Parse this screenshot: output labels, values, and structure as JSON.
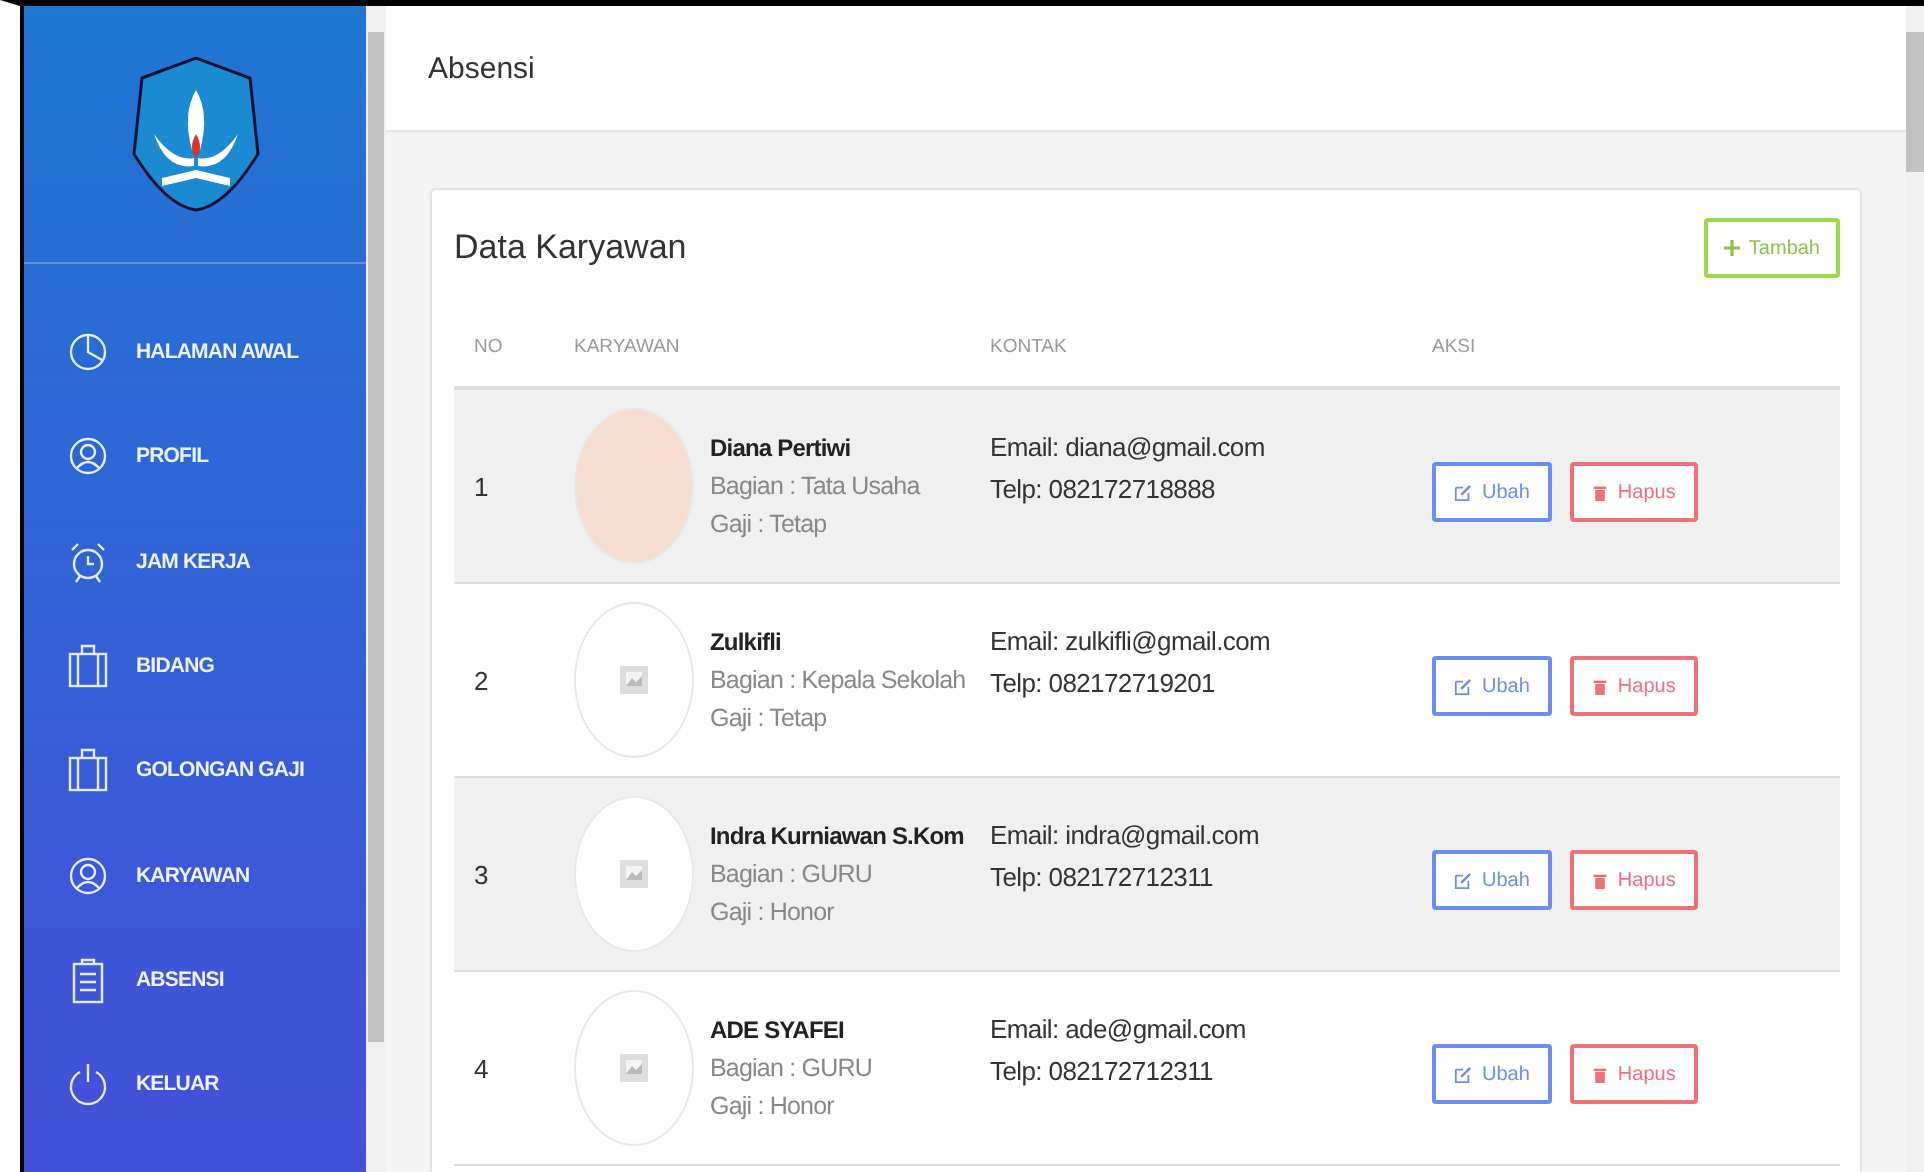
{
  "sidebar": {
    "items": [
      {
        "label": "HALAMAN AWAL",
        "kind": "chart"
      },
      {
        "label": "PROFIL",
        "kind": "person"
      },
      {
        "label": "JAM KERJA",
        "kind": "clock"
      },
      {
        "label": "BIDANG",
        "kind": "bag"
      },
      {
        "label": "GOLONGAN GAJI",
        "kind": "bag"
      },
      {
        "label": "KARYAWAN",
        "kind": "person"
      },
      {
        "label": "ABSENSI",
        "kind": "list"
      },
      {
        "label": "KELUAR",
        "kind": "exit"
      }
    ]
  },
  "page_title": "Absensi",
  "card": {
    "title": "Data Karyawan",
    "add_button": "Tambah"
  },
  "table": {
    "columns": [
      "NO",
      "KARYAWAN",
      "KONTAK",
      "AKSI"
    ],
    "rows": [
      {
        "no": "1",
        "kind": "photo",
        "name": "Diana Pertiwi",
        "bagian": "Bagian : Tata Usaha",
        "gaji": "Gaji : Tetap",
        "email": "Email: diana@gmail.com",
        "telp": "Telp: 082172718888",
        "edit": "Ubah",
        "delete": "Hapus"
      },
      {
        "no": "2",
        "kind": "placeholder",
        "name": "Zulkifli",
        "bagian": "Bagian : Kepala Sekolah",
        "gaji": "Gaji : Tetap",
        "email": "Email: zulkifli@gmail.com",
        "telp": "Telp: 082172719201",
        "edit": "Ubah",
        "delete": "Hapus"
      },
      {
        "no": "3",
        "kind": "placeholder",
        "name": "Indra Kurniawan S.Kom",
        "bagian": "Bagian : GURU",
        "gaji": "Gaji : Honor",
        "email": "Email: indra@gmail.com",
        "telp": "Telp: 082172712311",
        "edit": "Ubah",
        "delete": "Hapus"
      },
      {
        "no": "4",
        "kind": "placeholder",
        "name": "ADE SYAFEI",
        "bagian": "Bagian : GURU",
        "gaji": "Gaji : Honor",
        "email": "Email: ade@gmail.com",
        "telp": "Telp: 082172712311",
        "edit": "Ubah",
        "delete": "Hapus"
      }
    ]
  }
}
